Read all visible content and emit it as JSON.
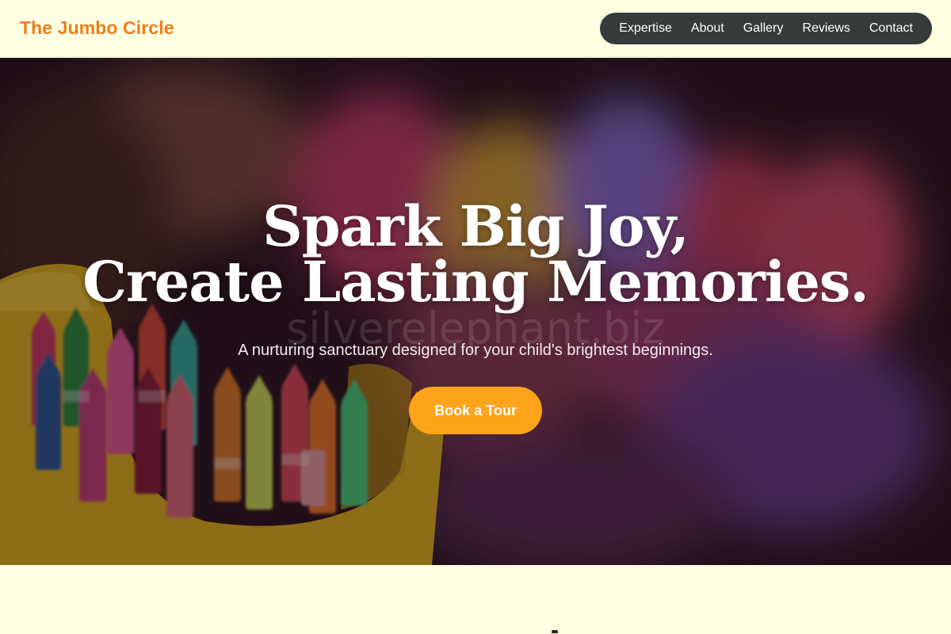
{
  "brand": {
    "name": "The Jumbo Circle",
    "color": "#ec7e1c"
  },
  "nav": {
    "items": [
      {
        "label": "Expertise"
      },
      {
        "label": "About"
      },
      {
        "label": "Gallery"
      },
      {
        "label": "Reviews"
      },
      {
        "label": "Contact"
      }
    ]
  },
  "hero": {
    "title_line1": "Spark Big Joy,",
    "title_line2": "Create Lasting Memories.",
    "subtitle": "A nurturing sanctuary designed for your child's brightest beginnings.",
    "cta_label": "Book a Tour",
    "cta_color": "#ffa31a",
    "watermark": "silverelephant.biz",
    "image": "crayons-in-yellow-box-background"
  }
}
